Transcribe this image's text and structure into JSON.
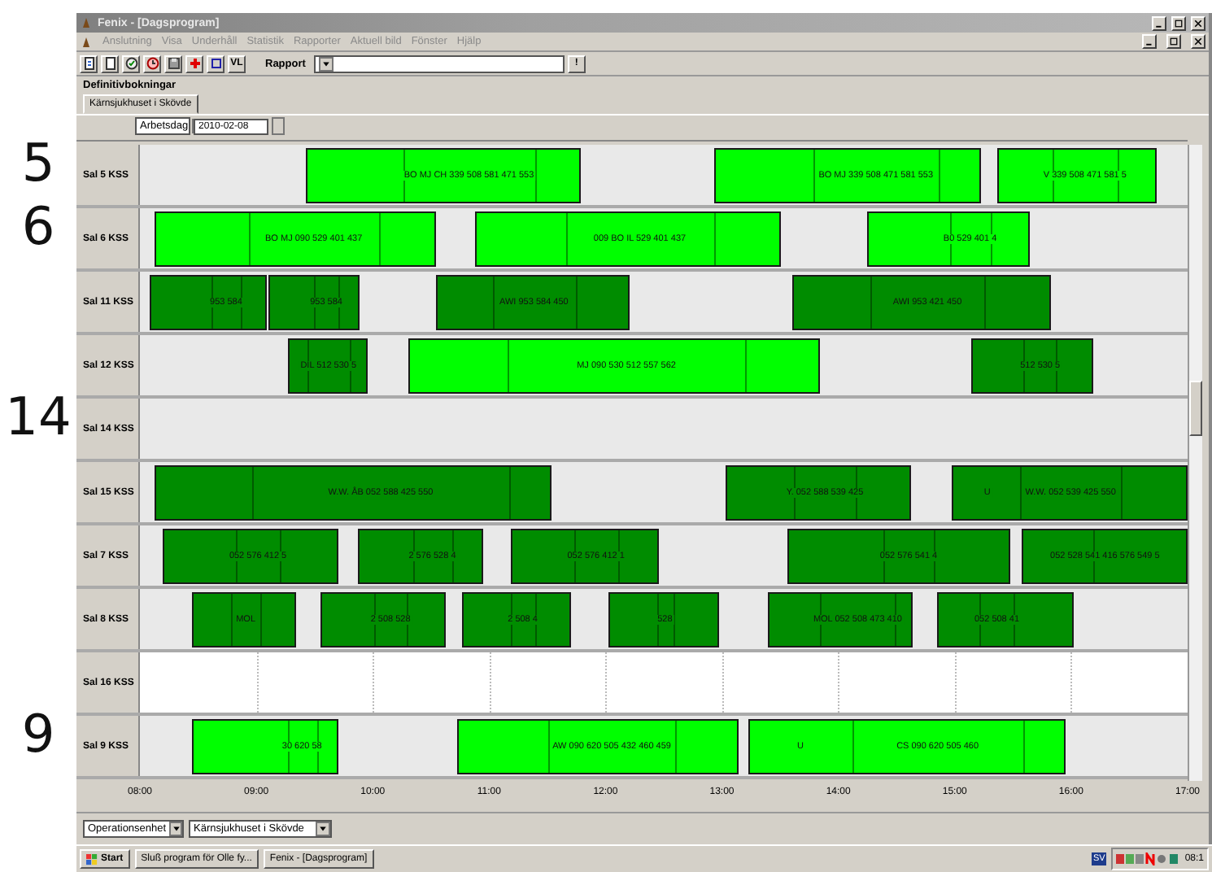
{
  "window": {
    "title": "Fenix - [Dagsprogram]"
  },
  "menu": [
    "Anslutning",
    "Visa",
    "Underhåll",
    "Statistik",
    "Rapporter",
    "Aktuell bild",
    "Fönster",
    "Hjälp"
  ],
  "toolbar": {
    "vl_button": "VL",
    "report_label": "Rapport",
    "run_button": "!"
  },
  "section_title": "Definitivbokningar",
  "tabs": [
    {
      "label": "Kärnsjukhuset i Skövde",
      "selected": true
    }
  ],
  "period_select": "Arbetsdag",
  "date_field": "2010-02-08",
  "rooms": [
    {
      "name": "Sal 5 KSS",
      "annotation": "5",
      "closed": false,
      "bookings": [
        {
          "kind": "light",
          "texts": [
            "BO MJ CH 339 508 581 471 553"
          ]
        },
        {
          "kind": "light",
          "texts": [
            "BO MJ 339 508 471 581 553"
          ]
        },
        {
          "kind": "light",
          "texts": [
            "V 339 508 471 581 5"
          ]
        }
      ]
    },
    {
      "name": "Sal 6 KSS",
      "annotation": "6",
      "closed": false,
      "bookings": [
        {
          "kind": "light",
          "texts": [
            "BO MJ 090 529 401 437"
          ]
        },
        {
          "kind": "light",
          "texts": [
            "009 BO IL 529 401 437"
          ]
        },
        {
          "kind": "light",
          "texts": [
            "B0 529 401 4"
          ]
        }
      ]
    },
    {
      "name": "Sal 11 KSS",
      "closed": false,
      "bookings": [
        {
          "kind": "dark",
          "texts": [
            "953 584"
          ]
        },
        {
          "kind": "dark",
          "texts": [
            "953 584"
          ]
        },
        {
          "kind": "dark",
          "texts": [
            "AWI 953 584 450"
          ]
        },
        {
          "kind": "dark",
          "texts": [
            "AWI 953 421 450"
          ]
        }
      ]
    },
    {
      "name": "Sal 12 KSS",
      "closed": false,
      "bookings": [
        {
          "kind": "dark",
          "texts": [
            "DIL 512 530 5"
          ]
        },
        {
          "kind": "light",
          "texts": [
            "MJ 090 530 512 557 562"
          ]
        },
        {
          "kind": "dark",
          "texts": [
            "512 530 5"
          ]
        }
      ]
    },
    {
      "name": "Sal 14 KSS",
      "annotation": "14",
      "closed": false
    },
    {
      "name": "Sal 15 KSS",
      "closed": false,
      "bookings": [
        {
          "kind": "dark",
          "texts": [
            "W.W. ÅB 052 588 425 550"
          ]
        },
        {
          "kind": "dark",
          "texts": [
            "Y. 052 588 539 425"
          ]
        },
        {
          "kind": "dark",
          "texts": [
            "U",
            "W.W. 052 539 425 550"
          ]
        }
      ]
    },
    {
      "name": "Sal 7 KSS",
      "closed": false,
      "bookings": [
        {
          "kind": "dark",
          "texts": [
            "052 576 412 5"
          ]
        },
        {
          "kind": "dark",
          "texts": [
            "2 576 528 4"
          ]
        },
        {
          "kind": "dark",
          "texts": [
            "052 576 412 1"
          ]
        },
        {
          "kind": "dark",
          "texts": [
            "052 576 541 4"
          ]
        },
        {
          "kind": "dark",
          "texts": [
            "052 528 541 416 576 549 5"
          ]
        }
      ]
    },
    {
      "name": "Sal 8 KSS",
      "closed": false,
      "bookings": [
        {
          "kind": "dark",
          "texts": [
            "MOL"
          ]
        },
        {
          "kind": "dark",
          "texts": [
            "2 508 528"
          ]
        },
        {
          "kind": "dark",
          "texts": [
            "2 508 4"
          ]
        },
        {
          "kind": "dark",
          "texts": [
            "528"
          ]
        },
        {
          "kind": "dark",
          "texts": [
            "MOL 052 508 473 410"
          ]
        },
        {
          "kind": "dark",
          "texts": [
            "052 508 41"
          ]
        }
      ]
    },
    {
      "name": "Sal 16 KSS",
      "closed": true
    },
    {
      "name": "Sal 9 KSS",
      "annotation": "9",
      "closed": false,
      "bookings": [
        {
          "kind": "light",
          "texts": [
            "30 620 58"
          ]
        },
        {
          "kind": "light",
          "texts": [
            "AW 090 620 505 432 460 459"
          ]
        },
        {
          "kind": "light",
          "texts": [
            "U",
            "CS 090 620 505 460"
          ]
        }
      ]
    }
  ],
  "axis_labels": [
    "08:00",
    "09:00",
    "10:00",
    "11:00",
    "12:00",
    "13:00",
    "14:00",
    "15:00",
    "16:00",
    "17:00"
  ],
  "filters": [
    "Operationsenhet",
    "Kärnsjukhuset i Skövde"
  ],
  "taskbar": {
    "start": "Start",
    "tasks": [
      "Sluß program för Olle fy...",
      "Fenix - [Dagsprogram]"
    ],
    "language": "SV",
    "clock": "08:1"
  }
}
